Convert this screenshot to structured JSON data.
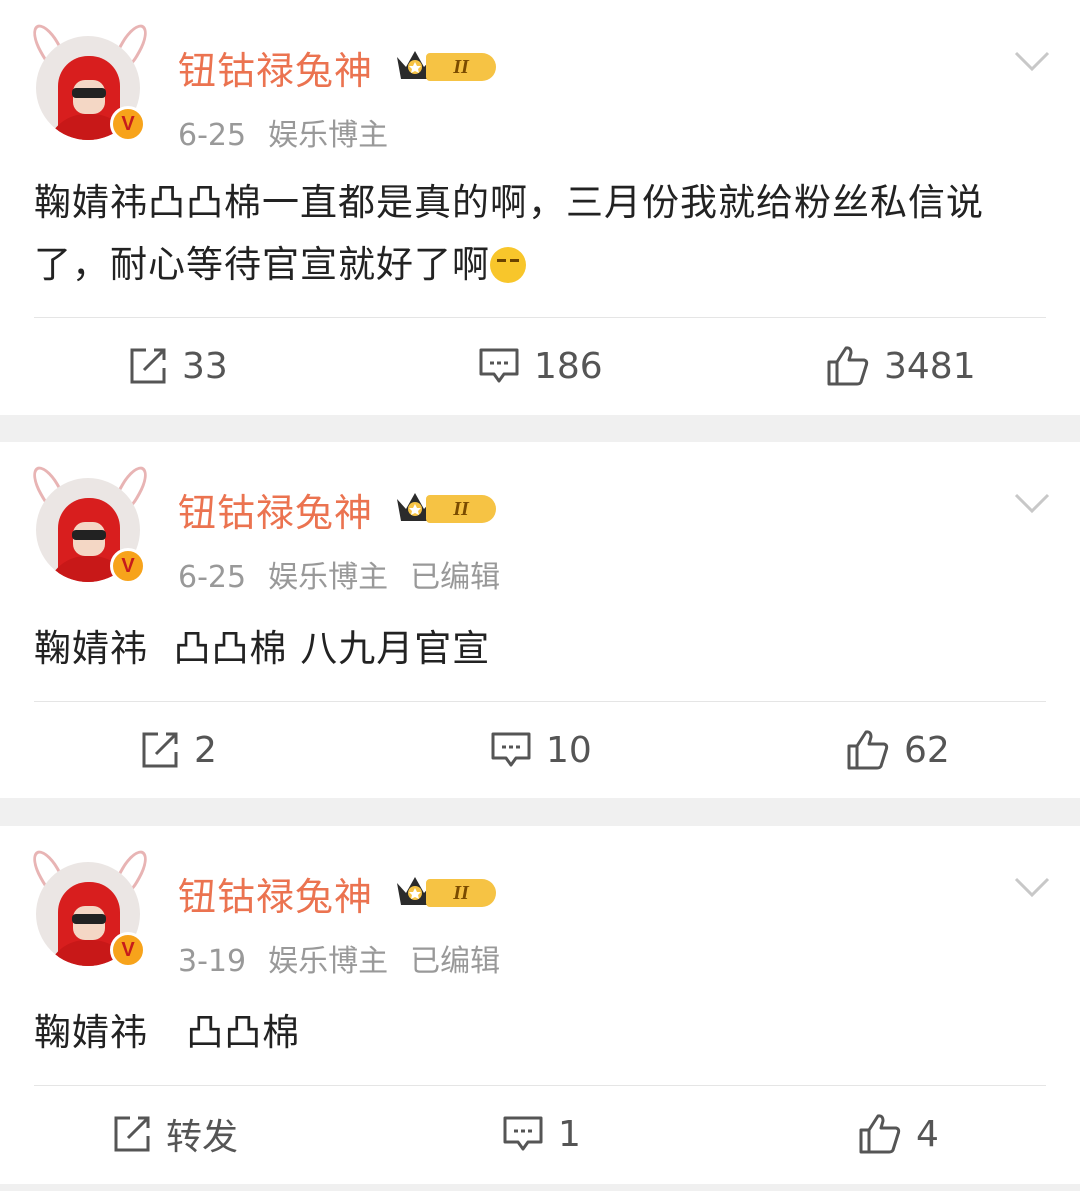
{
  "posts": [
    {
      "username": "钮钴禄兔神",
      "rank": "II",
      "date": "6-25",
      "role": "娱乐博主",
      "edited": "",
      "text": "鞠婧祎凸凸棉一直都是真的啊，三月份我就给粉丝私信说了，耐心等待官宣就好了啊",
      "emoji": "thinking-emoji",
      "repost": "33",
      "comments": "186",
      "likes": "3481"
    },
    {
      "username": "钮钴禄兔神",
      "rank": "II",
      "date": "6-25",
      "role": "娱乐博主",
      "edited": "已编辑",
      "text": "鞠婧祎  凸凸棉 八九月官宣",
      "repost": "2",
      "comments": "10",
      "likes": "62"
    },
    {
      "username": "钮钴禄兔神",
      "rank": "II",
      "date": "3-19",
      "role": "娱乐博主",
      "edited": "已编辑",
      "text": "鞠婧祎   凸凸棉",
      "repost": "转发",
      "comments": "1",
      "likes": "4"
    }
  ],
  "badge_letter": "V",
  "colors": {
    "username": "#eb7350",
    "meta": "#999999",
    "text": "#222222",
    "badge": "#f7a31b"
  }
}
